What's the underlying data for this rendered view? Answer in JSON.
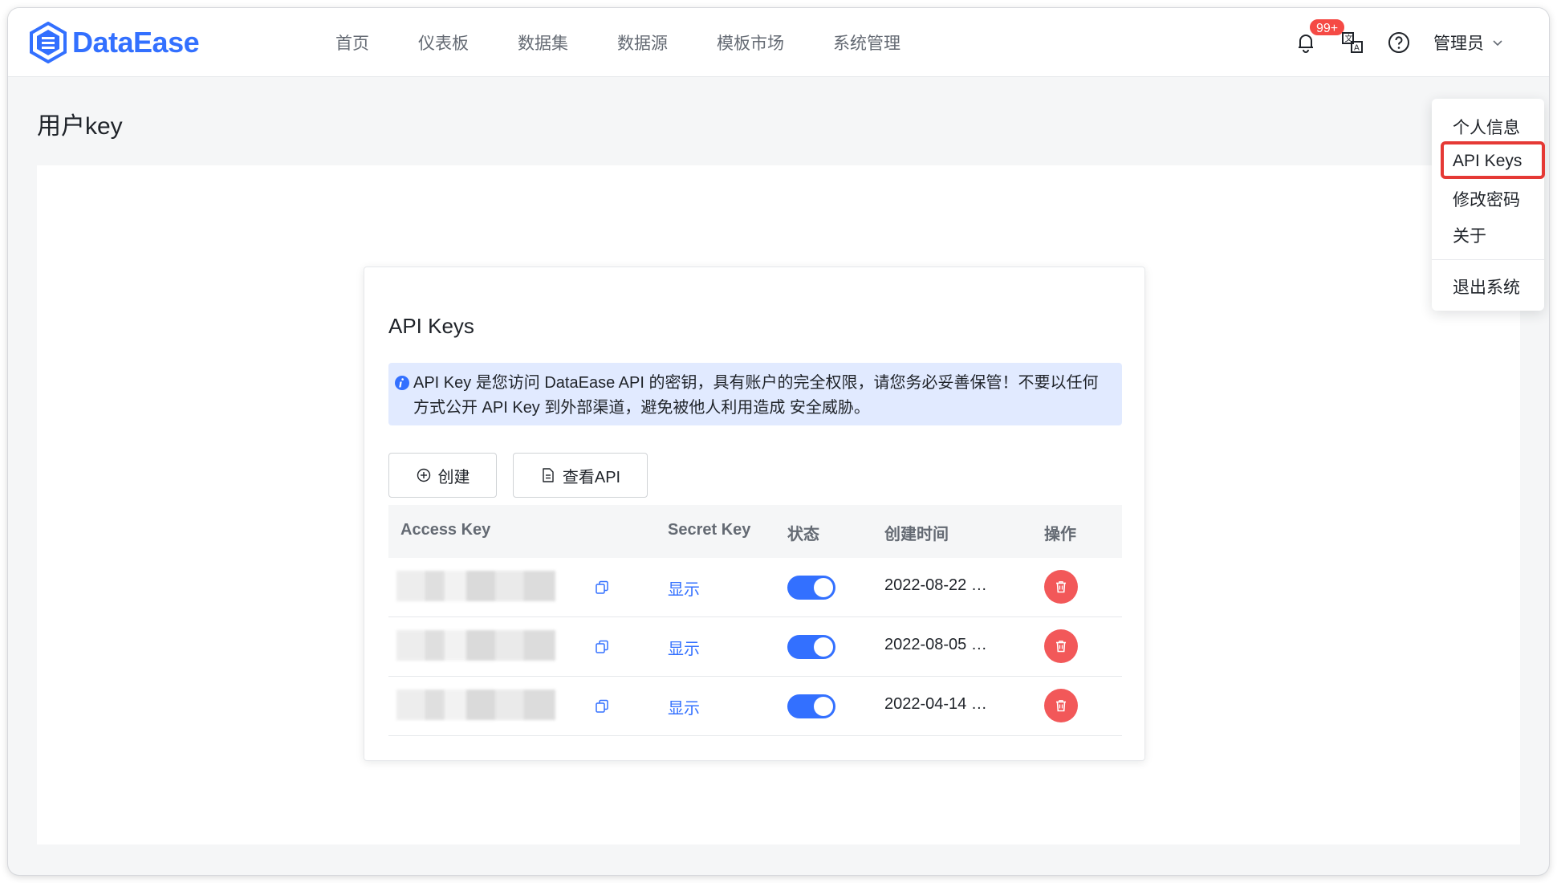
{
  "app": {
    "logo_text": "DataEase",
    "brand_color": "#3370ff"
  },
  "nav": {
    "items": [
      "首页",
      "仪表板",
      "数据集",
      "数据源",
      "模板市场",
      "系统管理"
    ]
  },
  "header": {
    "notification_badge": "99+",
    "user_label": "管理员"
  },
  "page": {
    "title": "用户key"
  },
  "card": {
    "title": "API Keys",
    "alert_text": "API Key 是您访问 DataEase API 的密钥，具有账户的完全权限，请您务必妥善保管！不要以任何方式公开 API Key 到外部渠道，避免被他人利用造成 安全威胁。",
    "create_label": "创建",
    "view_api_label": "查看API"
  },
  "table": {
    "headers": [
      "Access Key",
      "Secret Key",
      "状态",
      "创建时间",
      "操作"
    ],
    "rows": [
      {
        "secret_action": "显示",
        "enabled": true,
        "created": "2022-08-22 …"
      },
      {
        "secret_action": "显示",
        "enabled": true,
        "created": "2022-08-05 …"
      },
      {
        "secret_action": "显示",
        "enabled": true,
        "created": "2022-04-14 …"
      }
    ]
  },
  "user_dropdown": {
    "items": [
      "个人信息",
      "API Keys",
      "修改密码",
      "关于"
    ],
    "logout": "退出系统",
    "highlighted": "API Keys"
  }
}
